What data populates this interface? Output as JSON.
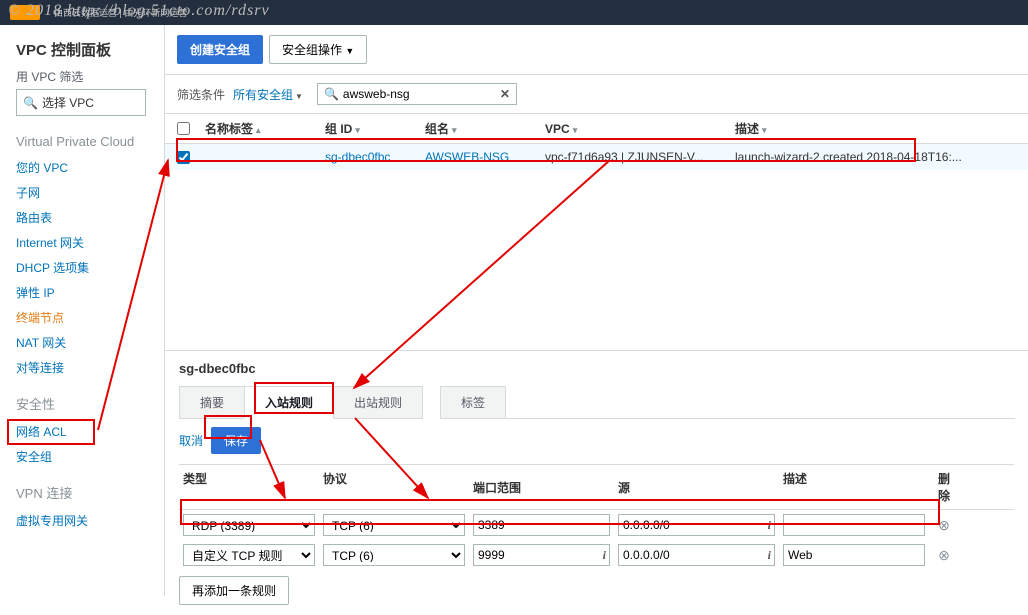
{
  "watermark": "© 2018 http://blog.51cto.com/rdsrv",
  "topbar": {
    "sub": "由西云数据运营 | 由光环新网运营",
    "services": "服务"
  },
  "sidebar": {
    "title": "VPC 控制面板",
    "filter_label": "用 VPC 筛选",
    "vpc_select": "选择 VPC",
    "sec_vpc": "Virtual Private Cloud",
    "items_vpc": [
      "您的 VPC",
      "子网",
      "路由表",
      "Internet 网关",
      "DHCP 选项集",
      "弹性 IP",
      "终端节点",
      "NAT 网关",
      "对等连接"
    ],
    "sec_security": "安全性",
    "items_sec": [
      "网络 ACL",
      "安全组"
    ],
    "sec_vpn": "VPN 连接",
    "items_vpn": [
      "虚拟专用网关"
    ]
  },
  "toolbar": {
    "create": "创建安全组",
    "actions": "安全组操作"
  },
  "filterbar": {
    "label": "筛选条件",
    "sel": "所有安全组",
    "search_value": "awsweb-nsg"
  },
  "table": {
    "headers": [
      "名称标签",
      "组 ID",
      "组名",
      "VPC",
      "描述"
    ],
    "row": {
      "name": "",
      "id": "sg-dbec0fbc",
      "gname": "AWSWEB-NSG",
      "vpc": "vpc-f71d6a93 | ZJUNSEN-V...",
      "desc": "launch-wizard-2 created 2018-04-18T16:..."
    }
  },
  "detail": {
    "title": "sg-dbec0fbc",
    "tabs": [
      "摘要",
      "入站规则",
      "出站规则",
      "标签"
    ],
    "active_tab": 1,
    "cancel": "取消",
    "save": "保存",
    "rule_headers": [
      "类型",
      "协议",
      "端口范围",
      "源",
      "描述",
      "删除"
    ],
    "rules": [
      {
        "type": "RDP (3389)",
        "proto": "TCP (6)",
        "port": "3389",
        "src": "0.0.0.0/0",
        "desc": "",
        "port_info": false,
        "src_info": true
      },
      {
        "type": "自定义 TCP 规则",
        "proto": "TCP (6)",
        "port": "9999",
        "src": "0.0.0.0/0",
        "desc": "Web",
        "port_info": true,
        "src_info": true
      }
    ],
    "add_rule": "再添加一条规则"
  }
}
